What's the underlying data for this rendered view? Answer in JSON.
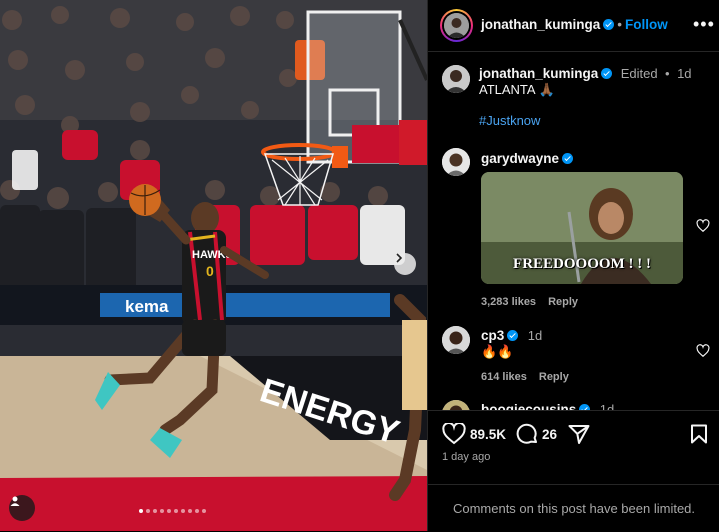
{
  "post": {
    "username": "jonathan_kuminga",
    "follow_label": "Follow",
    "separator": "•",
    "more_icon": "more-horizontal-icon"
  },
  "caption": {
    "username": "jonathan_kuminga",
    "edited_label": "Edited",
    "separator": "•",
    "time": "1d",
    "text": "ATLANTA 🙏🏾",
    "hashtag": "#Justknow"
  },
  "comments": [
    {
      "username": "garydwayne",
      "gif_text": "FREEDOOOOM ! ! !",
      "likes": "3,283 likes",
      "reply_label": "Reply"
    },
    {
      "username": "cp3",
      "time": "1d",
      "text": "🔥🔥",
      "likes": "614 likes",
      "reply_label": "Reply"
    },
    {
      "username": "boogiecousins",
      "time": "1d"
    }
  ],
  "actions": {
    "like_count": "89.5K",
    "comment_count": "26",
    "time_ago": "1 day ago"
  },
  "footer": {
    "limited_text": "Comments on this post have been limited."
  },
  "photo": {
    "jersey_text": "HAWKS",
    "jersey_number": "0",
    "court_text": "ENERGY",
    "banner_text": "kema",
    "carousel_count": 10,
    "carousel_active": 0
  },
  "colors": {
    "link_blue": "#0095f6",
    "panel_bg": "#000000",
    "hawks_red": "#c8102e"
  }
}
